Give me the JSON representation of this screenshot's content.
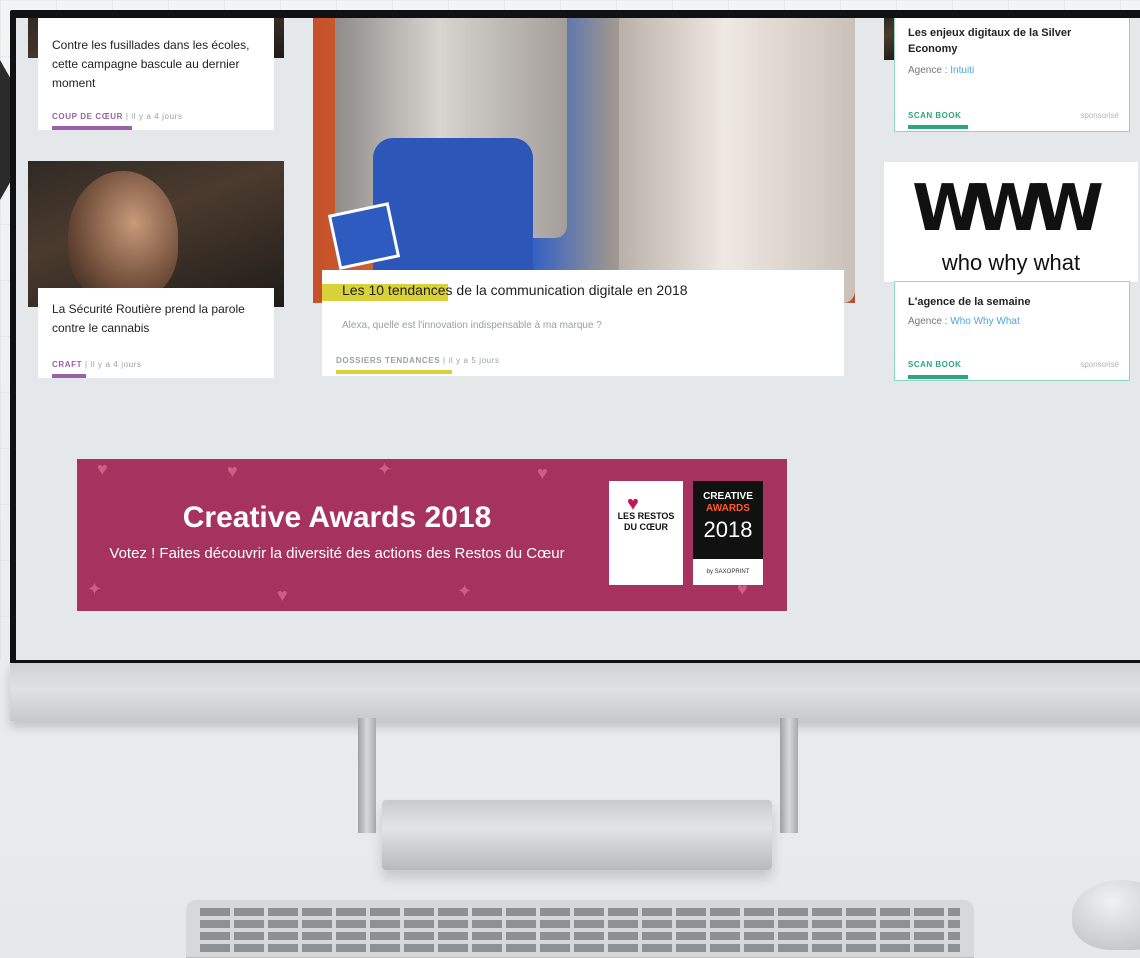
{
  "articles": [
    {
      "title": "Contre les fusillades dans les écoles, cette campagne bascule au dernier moment",
      "category": "COUP DE CŒUR",
      "time": "il y a 4 jours",
      "accent": "#9b5fa8"
    },
    {
      "title": "La Sécurité Routière prend la parole contre le cannabis",
      "category": "CRAFT",
      "time": "il y a 4 jours",
      "accent": "#9b5fa8"
    }
  ],
  "featured": {
    "title_highlight": "Les 10 tendance",
    "title_rest": "s de la communication digitale en 2018",
    "subtitle": "Alexa, quelle est l'innovation indispensable à ma marque ?",
    "category": "DOSSIERS TENDANCES",
    "time": "il y a 5 jours",
    "accent": "#d8d13a"
  },
  "sponsored": [
    {
      "title": "Les enjeux digitaux de la Silver Economy",
      "agency_label": "Agence : ",
      "agency_name": "Intuiti",
      "cta": "SCAN BOOK",
      "sponsor": "sponsorisé"
    },
    {
      "logo_word": "WWW",
      "logo_tagline": "who why what",
      "title": "L'agence de la semaine",
      "agency_label": "Agence : ",
      "agency_name": "Who Why What",
      "cta": "SCAN BOOK",
      "sponsor": "sponsorisé"
    }
  ],
  "banner": {
    "title": "Creative Awards 2018",
    "subtitle": "Votez ! Faites découvrir la diversité des actions des Restos du Cœur",
    "logo_text": "LES RESTOS DU CŒUR",
    "award_line1": "CREATIVE",
    "award_line2": "AWARDS",
    "award_year": "2018",
    "award_sponsor": "by SAXOPRINT",
    "background": "#a6325f"
  },
  "colors": {
    "accent_green": "#2da57f",
    "accent_yellow": "#d8d13a",
    "accent_purple": "#9b5fa8",
    "link_blue": "#4aa6e0"
  }
}
